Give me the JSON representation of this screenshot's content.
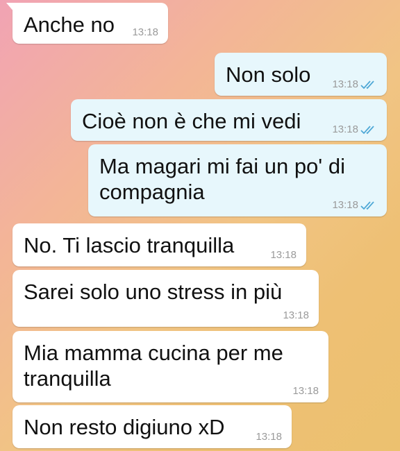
{
  "colors": {
    "incoming_bubble": "#ffffff",
    "outgoing_bubble": "#e7f7fc",
    "read_tick": "#4fa8d6",
    "timestamp": "#9a9a9a"
  },
  "messages": [
    {
      "id": "m1",
      "direction": "in",
      "text": "Anche no",
      "time": "13:18"
    },
    {
      "id": "m2",
      "direction": "out",
      "text": "Non solo",
      "time": "13:18",
      "status_icon": "double-check-icon"
    },
    {
      "id": "m3",
      "direction": "out",
      "text": "Cioè non è che mi vedi",
      "time": "13:18",
      "status_icon": "double-check-icon"
    },
    {
      "id": "m4",
      "direction": "out",
      "text": "Ma magari mi fai un po' di\ncompagnia",
      "time": "13:18",
      "status_icon": "double-check-icon"
    },
    {
      "id": "m5",
      "direction": "in",
      "text": "No. Ti lascio tranquilla",
      "time": "13:18"
    },
    {
      "id": "m6",
      "direction": "in",
      "text": "Sarei solo uno stress in più",
      "time": "13:18"
    },
    {
      "id": "m7",
      "direction": "in",
      "text": "Mia mamma cucina per me\ntranquilla",
      "time": "13:18"
    },
    {
      "id": "m8",
      "direction": "in",
      "text": "Non resto digiuno xD",
      "time": "13:18"
    }
  ]
}
